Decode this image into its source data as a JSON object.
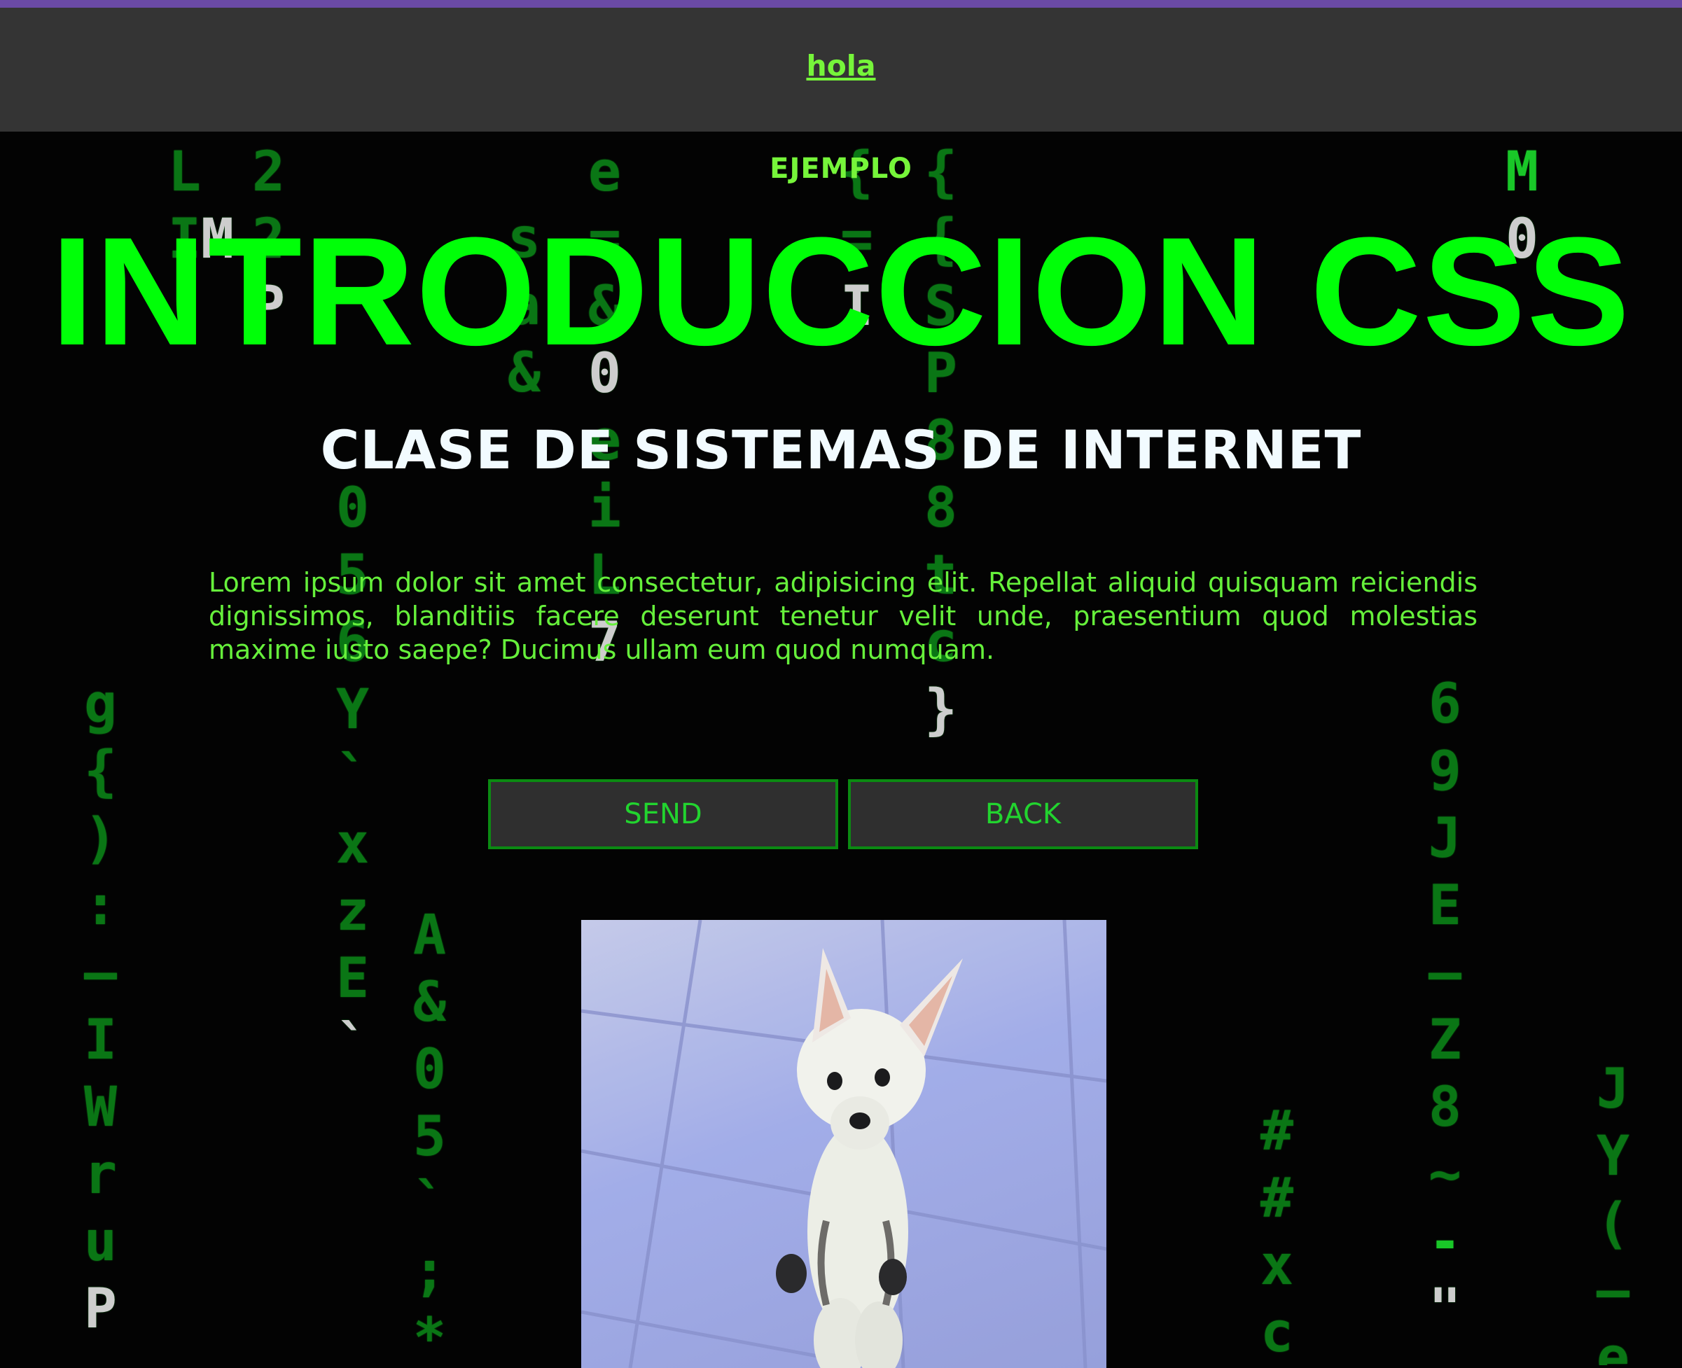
{
  "navbar": {
    "link_label": "hola"
  },
  "hero": {
    "eyebrow": "EJEMPLO",
    "title": "INTRODUCCION CSS",
    "subtitle": "CLASE DE SISTEMAS DE INTERNET"
  },
  "body": {
    "paragraph": "Lorem ipsum dolor sit amet consectetur, adipisicing elit. Repellat aliquid quisquam reiciendis dignissimos, blanditiis facere deserunt tenetur velit unde, praesentium quod molestias maxime iusto saepe? Ducimus ullam eum quod numquam."
  },
  "buttons": {
    "send_label": "SEND",
    "back_label": "BACK"
  },
  "image": {
    "subject": "white chihuahua standing on hind legs"
  },
  "colors": {
    "accent_green": "#00ff08",
    "text_green": "#66f03b",
    "nav_bg": "#343434",
    "top_stripe": "#6b4aa6",
    "background": "#030303"
  }
}
